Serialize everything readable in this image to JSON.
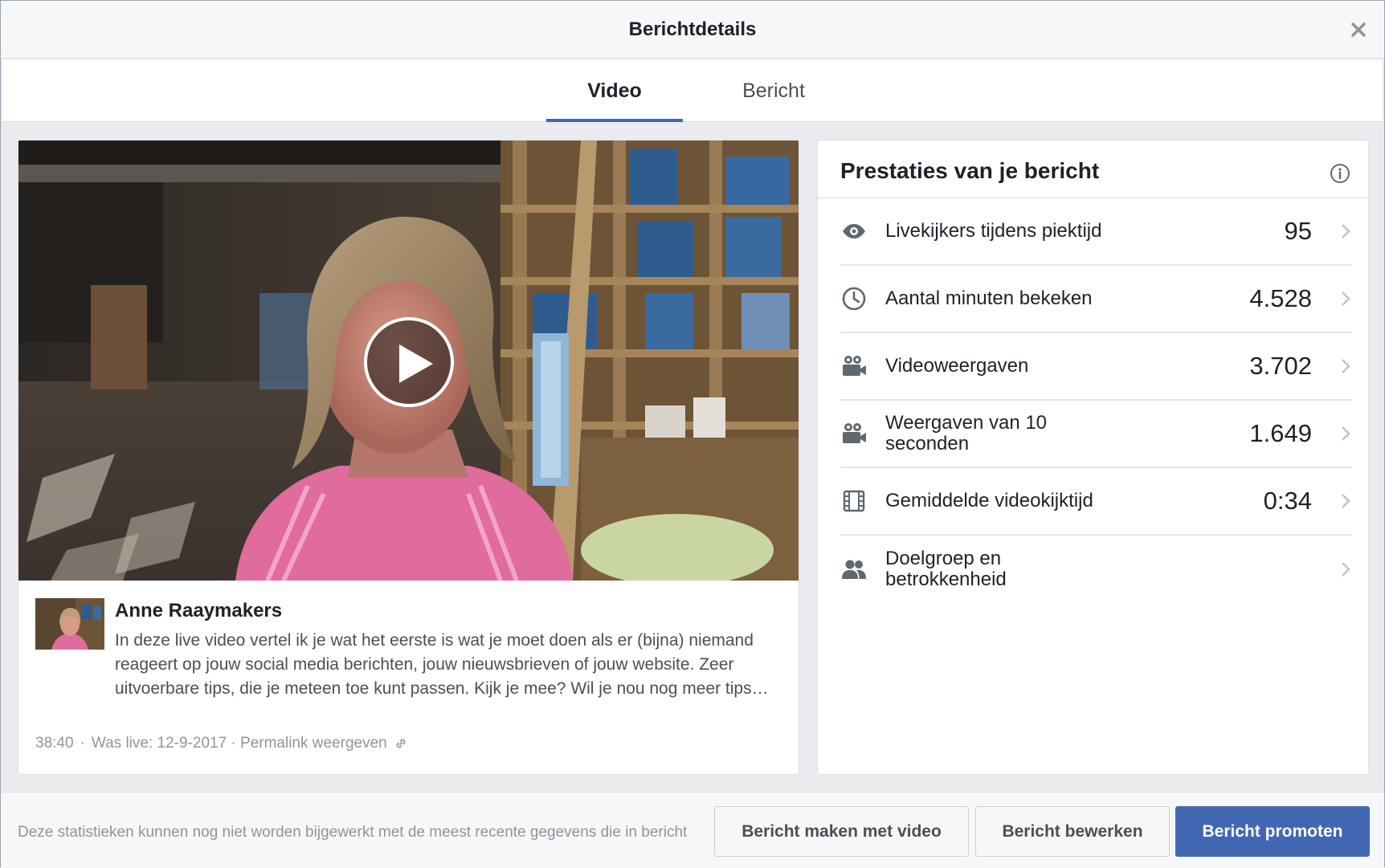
{
  "header": {
    "title": "Berichtdetails",
    "close_icon": "close-icon"
  },
  "tabs": [
    {
      "label": "Video",
      "active": true
    },
    {
      "label": "Bericht",
      "active": false
    }
  ],
  "post": {
    "author": "Anne Raaymakers",
    "text": "In deze live video vertel ik je wat het eerste is wat je moet doen als er (bijna) niemand reageert op jouw social media berichten, jouw nieuwsbrieven of jouw website. Zeer uitvoerbare tips, die je meteen toe kunt passen. Kijk je mee? Wil je nou nog meer tips…",
    "duration": "38:40",
    "separator": "·",
    "was_live": "Was live: 12-9-2017 · Permalink weergeven"
  },
  "performance": {
    "title": "Prestaties van je bericht",
    "metrics": [
      {
        "icon": "eye-icon",
        "label": "Livekijkers tijdens piektijd",
        "value": "95"
      },
      {
        "icon": "clock-icon",
        "label": "Aantal minuten bekeken",
        "value": "4.528"
      },
      {
        "icon": "video-camera-icon",
        "label": "Videoweergaven",
        "value": "3.702"
      },
      {
        "icon": "video-camera-icon",
        "label": "Weergaven van 10 seconden",
        "value": "1.649"
      },
      {
        "icon": "film-icon",
        "label": "Gemiddelde videokijktijd",
        "value": "0:34"
      },
      {
        "icon": "people-icon",
        "label": "Doelgroep en betrokkenheid",
        "value": ""
      }
    ]
  },
  "footer": {
    "note": "Deze statistieken kunnen nog niet worden bijgewerkt met de meest recente gegevens die in bericht",
    "buttons": {
      "create": "Bericht maken met video",
      "edit": "Bericht bewerken",
      "promote": "Bericht promoten"
    }
  },
  "colors": {
    "brand": "#4267b2",
    "muted": "#90949c",
    "text": "#1d2129"
  }
}
